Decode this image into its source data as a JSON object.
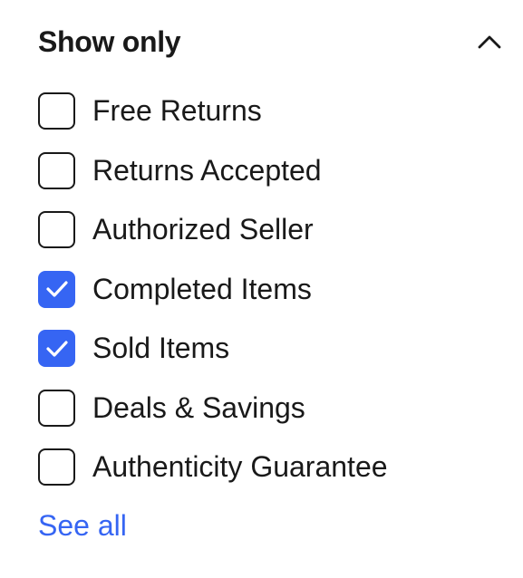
{
  "filter": {
    "title": "Show only",
    "expanded_icon": "chevron-up-icon",
    "accent_color": "#3665f3",
    "options": [
      {
        "label": "Free Returns",
        "checked": false
      },
      {
        "label": "Returns Accepted",
        "checked": false
      },
      {
        "label": "Authorized Seller",
        "checked": false
      },
      {
        "label": "Completed Items",
        "checked": true
      },
      {
        "label": "Sold Items",
        "checked": true
      },
      {
        "label": "Deals & Savings",
        "checked": false
      },
      {
        "label": "Authenticity Guarantee",
        "checked": false
      }
    ],
    "see_all_label": "See all"
  }
}
